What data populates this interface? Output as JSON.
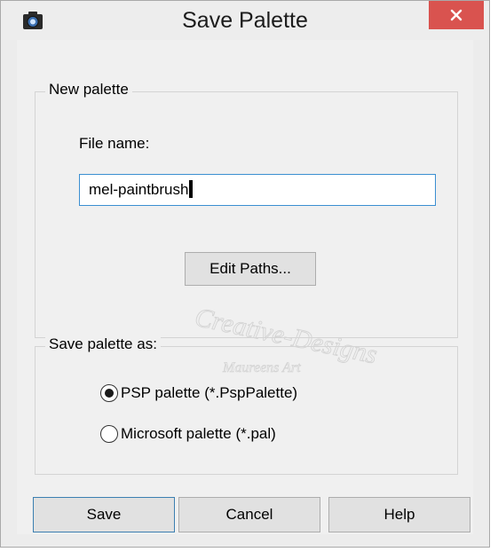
{
  "window": {
    "title": "Save Palette",
    "app_icon": "camera-icon",
    "close_icon": "close-icon"
  },
  "new_palette": {
    "group_label": "New palette",
    "file_name_label": "File name:",
    "file_name_value": "mel-paintbrush",
    "edit_paths_label": "Edit Paths..."
  },
  "save_as": {
    "group_label": "Save palette as:",
    "options": [
      {
        "label": "PSP palette (*.PspPalette)",
        "selected": true
      },
      {
        "label": "Microsoft palette (*.pal)",
        "selected": false
      }
    ]
  },
  "buttons": {
    "save": "Save",
    "cancel": "Cancel",
    "help": "Help"
  },
  "watermark": {
    "line1": "Creative-Designs",
    "line2": "Maureens Art"
  },
  "colors": {
    "close_button": "#d9534f",
    "input_border": "#3b8fd1"
  }
}
